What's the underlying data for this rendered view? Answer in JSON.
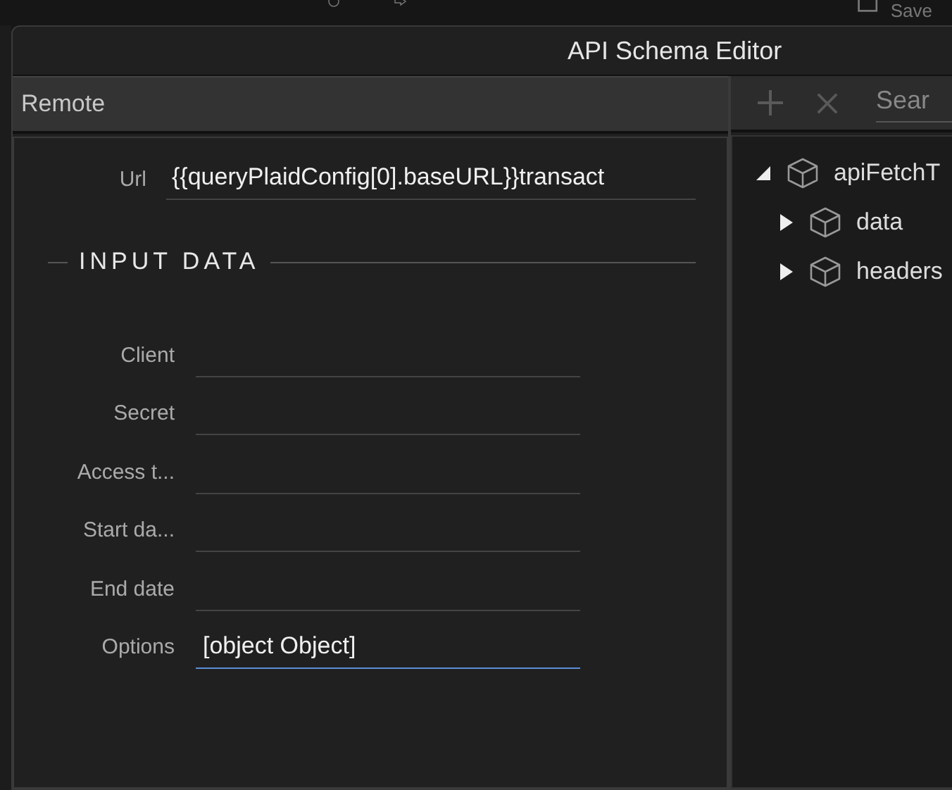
{
  "background": {
    "save_label": "Save"
  },
  "window": {
    "title": "API Schema Editor"
  },
  "left_panel": {
    "title": "Remote",
    "url": {
      "label": "Url",
      "value": "{{queryPlaidConfig[0].baseURL}}transact"
    },
    "section_title": "INPUT DATA",
    "fields": [
      {
        "label": "Client",
        "focused": false
      },
      {
        "label": "Secret",
        "focused": false
      },
      {
        "label": "Access t...",
        "focused": false
      },
      {
        "label": "Start da...",
        "focused": false
      },
      {
        "label": "End date",
        "focused": false
      },
      {
        "label": "Options",
        "value": "[object Object]",
        "focused": true
      }
    ]
  },
  "right_panel": {
    "search": {
      "placeholder": "Sear"
    },
    "tree": [
      {
        "label": "apiFetchT",
        "expanded": true,
        "children": [
          {
            "label": "data",
            "expanded": false
          },
          {
            "label": "headers",
            "expanded": false
          }
        ]
      }
    ]
  }
}
